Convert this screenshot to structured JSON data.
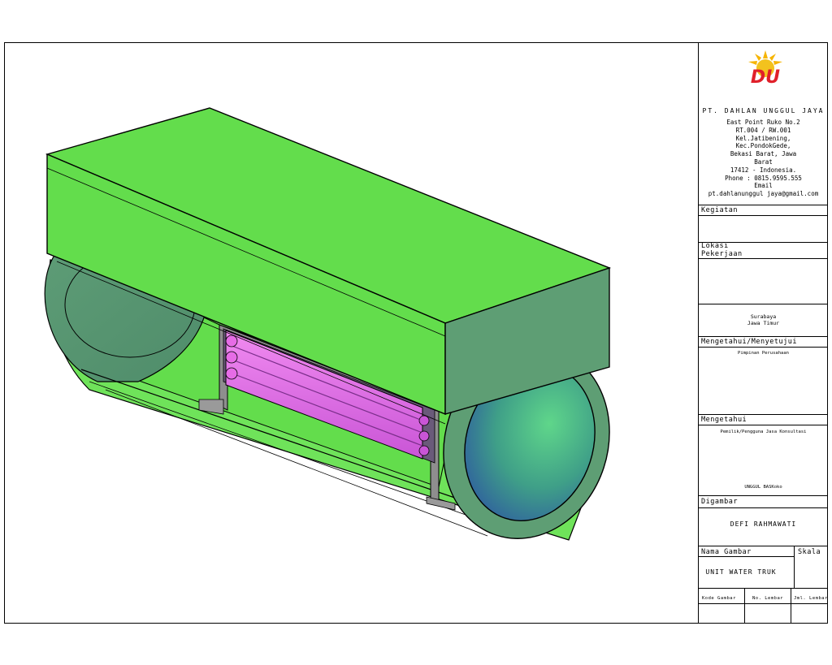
{
  "title_block": {
    "company": {
      "name": "PT. DAHLAN UNGGUL JAYA",
      "logo_text": "DU",
      "address_lines": [
        "East Point Ruko No.2",
        "RT.004 / RW.001",
        "Kel.Jatibening,",
        "Kec.PondokGede,",
        "Bekasi Barat, Jawa",
        "Barat",
        "17412 - Indonesia.",
        "Phone : 0815.9595.555",
        "Email",
        "pt.dahlanunggul jaya@gmail.com"
      ]
    },
    "kegiatan": {
      "label": "Kegiatan",
      "value": ""
    },
    "lokasi": {
      "label": "Lokasi",
      "label2": "Pekerjaan",
      "value_line1": "Surabaya",
      "value_line2": "Jawa Timur"
    },
    "mengetahui_menyetujui": {
      "label": "Mengetahui/Menyetujui",
      "value": "Pimpinan Perusahaan"
    },
    "mengetahui": {
      "label": "Mengetahui",
      "role": "Pemilik/Pengguna Jasa Konsultasi",
      "name": "UNGGUL BASKoko"
    },
    "digambar": {
      "label": "Digambar",
      "value": "DEFI RAHMAWATI"
    },
    "nama_gambar": {
      "label": "Nama Gambar",
      "value": "UNIT WATER TRUK"
    },
    "skala": {
      "label": "Skala"
    },
    "footer": {
      "kode": "Kode Gambar",
      "no_lembar": "No. Lembar",
      "jml_lembar": "Jml. Lembar"
    }
  },
  "colors": {
    "green": "#63dd4c",
    "tank_side": "#5e9e74",
    "pink": "#e66ce6",
    "dark_outline": "#000000"
  }
}
